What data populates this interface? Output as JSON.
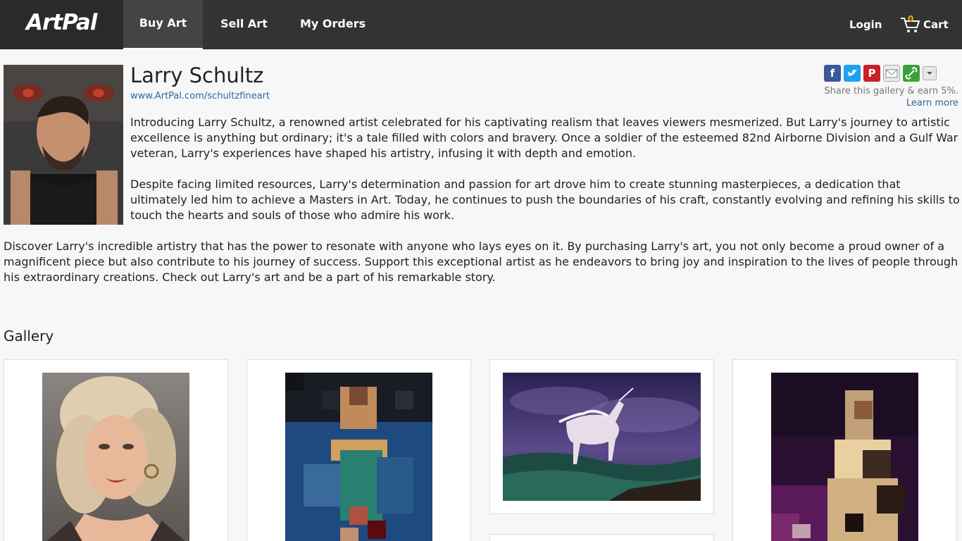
{
  "header": {
    "logo": "ArtPal",
    "nav": [
      {
        "label": "Buy Art"
      },
      {
        "label": "Sell Art"
      },
      {
        "label": "My Orders"
      }
    ],
    "login": "Login",
    "cart_label": "Cart",
    "cart_count": "0"
  },
  "artist": {
    "name": "Larry Schultz",
    "url": "www.ArtPal.com/schultzfineart",
    "bio": [
      "Introducing Larry Schultz, a renowned artist celebrated for his captivating realism that leaves viewers mesmerized. But Larry's journey to artistic excellence is anything but ordinary; it's a tale filled with colors and bravery. Once a soldier of the esteemed 82nd Airborne Division and a Gulf War veteran, Larry's experiences have shaped his artistry, infusing it with depth and emotion.",
      "Despite facing limited resources, Larry's determination and passion for art drove him to create stunning masterpieces, a dedication that ultimately led him to achieve a Masters in Art. Today, he continues to push the boundaries of his craft, constantly evolving and refining his skills to touch the hearts and souls of those who admire his work.",
      "Discover Larry's incredible artistry that has the power to resonate with anyone who lays eyes on it. By purchasing Larry's art, you not only become a proud owner of a magnificent piece but also contribute to his journey of success. Support this exceptional artist as he endeavors to bring joy and inspiration to the lives of people through his extraordinary creations. Check out Larry's art and be a part of his remarkable story."
    ]
  },
  "share": {
    "text": "Share this gallery & earn 5%.",
    "learn_more": "Learn more",
    "icons": [
      "facebook-icon",
      "twitter-icon",
      "pinterest-icon",
      "email-icon",
      "link-icon",
      "more-icon"
    ]
  },
  "gallery": {
    "title": "Gallery"
  },
  "colors": {
    "topbar": "#333333",
    "link": "#336699",
    "cart_count": "#f5a623"
  }
}
